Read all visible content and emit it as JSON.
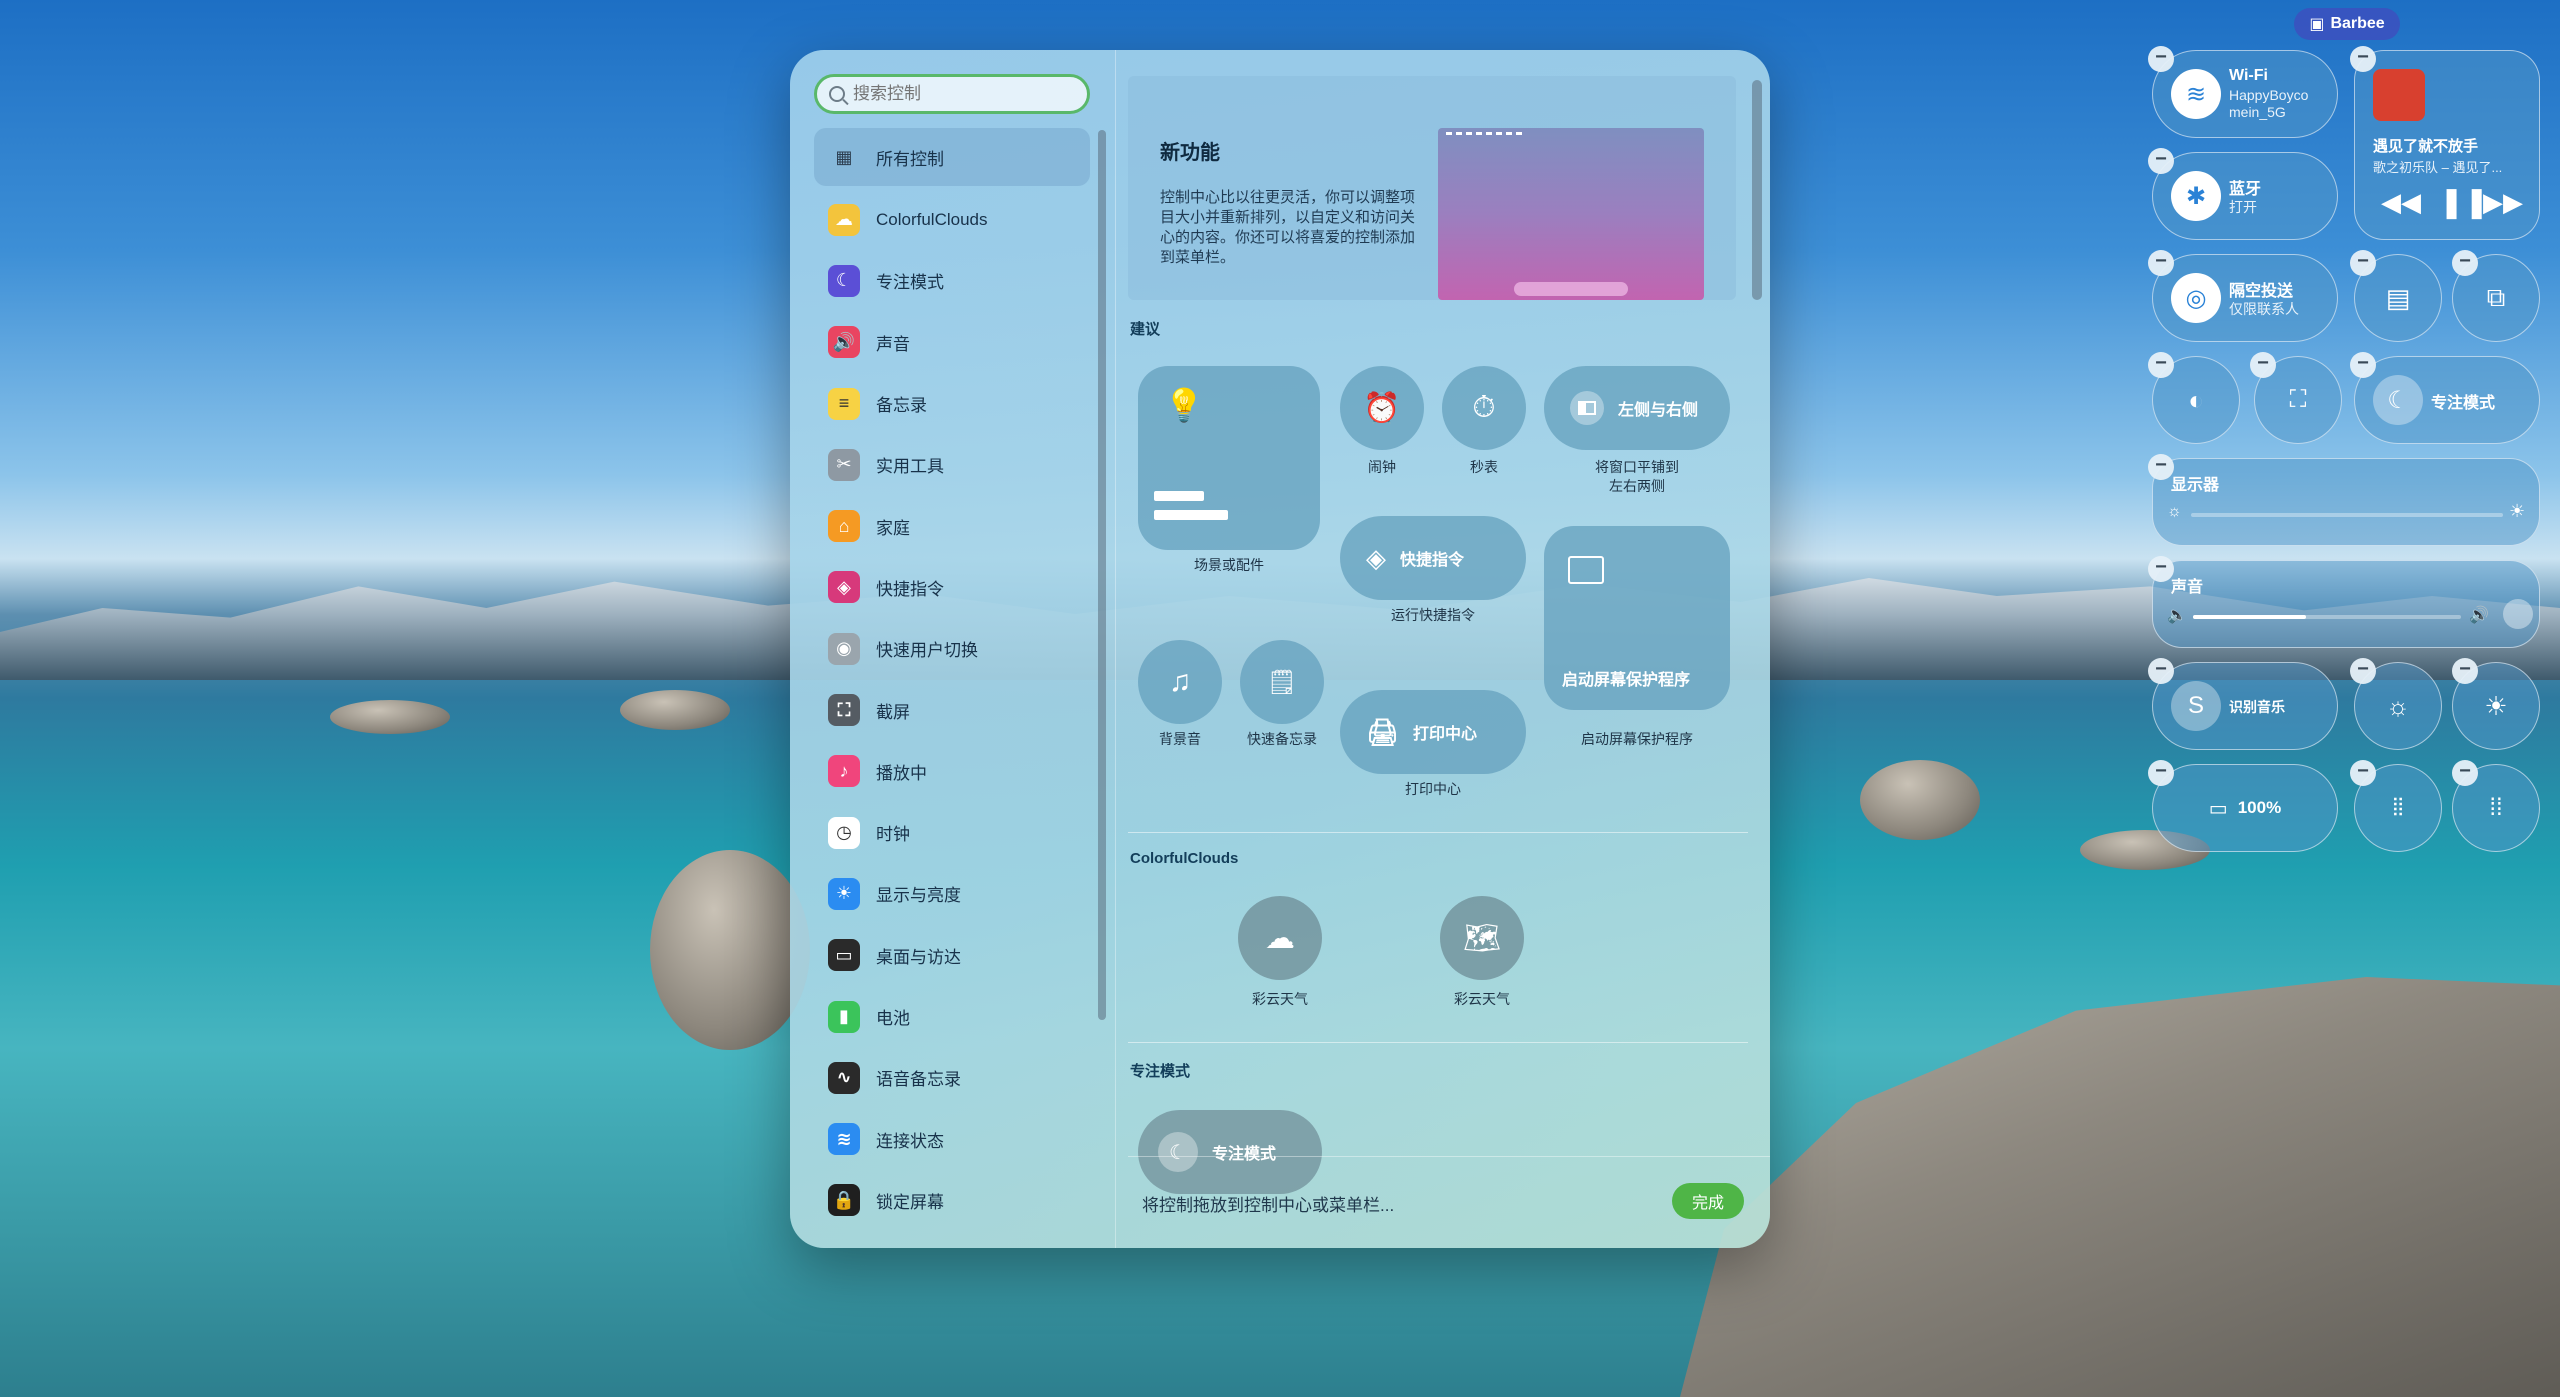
{
  "search": {
    "placeholder": "搜索控制"
  },
  "sidebar": {
    "items": [
      {
        "label": "所有控制",
        "icon": "grid-icon",
        "color": "#2c3e50"
      },
      {
        "label": "ColorfulClouds",
        "icon": "cloud-icon",
        "color": "#f3c43c"
      },
      {
        "label": "专注模式",
        "icon": "moon-icon",
        "color": "#5b4fd6"
      },
      {
        "label": "声音",
        "icon": "speaker-icon",
        "color": "#e94561"
      },
      {
        "label": "备忘录",
        "icon": "notes-icon",
        "color": "#f7d244"
      },
      {
        "label": "实用工具",
        "icon": "tools-icon",
        "color": "#8e99a3"
      },
      {
        "label": "家庭",
        "icon": "home-icon",
        "color": "#f59a23"
      },
      {
        "label": "快捷指令",
        "icon": "shortcuts-icon",
        "color": "#d7397b"
      },
      {
        "label": "快速用户切换",
        "icon": "user-icon",
        "color": "#9aa5ad"
      },
      {
        "label": "截屏",
        "icon": "screenshot-icon",
        "color": "#555c63"
      },
      {
        "label": "播放中",
        "icon": "now-playing-icon",
        "color": "#f0457c"
      },
      {
        "label": "时钟",
        "icon": "clock-icon",
        "color": "#ffffff"
      },
      {
        "label": "显示与亮度",
        "icon": "sun-icon",
        "color": "#2b8cf1"
      },
      {
        "label": "桌面与访达",
        "icon": "desktop-icon",
        "color": "#2a2a2a"
      },
      {
        "label": "电池",
        "icon": "battery-icon",
        "color": "#3bc45b"
      },
      {
        "label": "语音备忘录",
        "icon": "voice-memo-icon",
        "color": "#2a2a2a"
      },
      {
        "label": "连接状态",
        "icon": "wifi-icon",
        "color": "#2b8cf1"
      },
      {
        "label": "锁定屏幕",
        "icon": "lock-icon",
        "color": "#1f1f1f"
      }
    ]
  },
  "news": {
    "title": "新功能",
    "body": "控制中心比以往更灵活，你可以调整项目大小并重新排列，以自定义和访问关心的内容。你还可以将喜爱的控制添加到菜单栏。"
  },
  "suggestions": {
    "label": "建议",
    "items": {
      "scene": "场景或配件",
      "alarm": "闹钟",
      "stopwatch": "秒表",
      "tile_left_right": "左侧与右侧",
      "tile_caption": "将窗口平铺到\n左右两侧",
      "shortcuts": "快捷指令",
      "shortcuts_caption": "运行快捷指令",
      "background_sound": "背景音",
      "quick_note": "快速备忘录",
      "print_center": "打印中心",
      "print_caption": "打印中心",
      "screensaver": "启动屏幕保护程序",
      "screensaver_caption": "启动屏幕保护程序"
    }
  },
  "colorful_clouds": {
    "label": "ColorfulClouds",
    "items": [
      "彩云天气",
      "彩云天气"
    ]
  },
  "focus": {
    "label": "专注模式",
    "item": "专注模式"
  },
  "footer": {
    "hint": "将控制拖放到控制中心或菜单栏...",
    "done": "完成"
  },
  "control_center": {
    "badge": "Barbee",
    "wifi": {
      "title": "Wi-Fi",
      "sub": "HappyBoyco\nmein_5G"
    },
    "bluetooth": {
      "title": "蓝牙",
      "sub": "打开"
    },
    "airdrop": {
      "title": "隔空投送",
      "sub": "仅限联系人"
    },
    "music": {
      "title": "遇见了就不放手",
      "sub": "歌之初乐队 – 遇见了..."
    },
    "focus": "专注模式",
    "display": {
      "title": "显示器",
      "level": 0
    },
    "sound": {
      "title": "声音",
      "level": 0.42
    },
    "music_recognition": "识别音乐",
    "battery": "100%"
  }
}
